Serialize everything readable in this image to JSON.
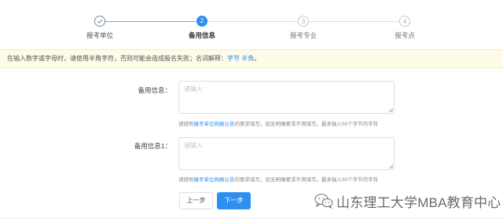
{
  "stepper": {
    "steps": [
      {
        "number": "1",
        "label": "报考单位",
        "state": "done"
      },
      {
        "number": "2",
        "label": "备用信息",
        "state": "active"
      },
      {
        "number": "3",
        "label": "报考专业",
        "state": "todo"
      },
      {
        "number": "4",
        "label": "报考点",
        "state": "todo"
      }
    ],
    "colors": {
      "done_line": "#5fb4d6",
      "todo_line": "#dcdcdc",
      "active": "#2d8ff0"
    }
  },
  "notice": {
    "text": "在输入数字或字母时，请使用半角字符，否则可能会造成报名失败；名词解释：",
    "link_1": "字节",
    "link_2": "半角",
    "end": "。",
    "background": "#fefbe8"
  },
  "form": {
    "field_1": {
      "label": "备用信息：",
      "placeholder": "请输入",
      "hint_prefix": "请按照",
      "hint_link": "报考单位网报公告",
      "hint_suffix": "的要求填写，如无明确要求不用填写。最多输入50个字节的字符"
    },
    "field_2": {
      "label": "备用信息1：",
      "placeholder": "请输入",
      "hint_prefix": "请按照",
      "hint_link": "报考单位网报公告",
      "hint_suffix": "的要求填写，如无明确要求不用填写。最多输入50个字节的字符"
    }
  },
  "buttons": {
    "prev_label": "上一步",
    "next_label": "下一步"
  },
  "watermark": {
    "text": "山东理工大学MBA教育中心",
    "icon": "wechat-icon"
  }
}
